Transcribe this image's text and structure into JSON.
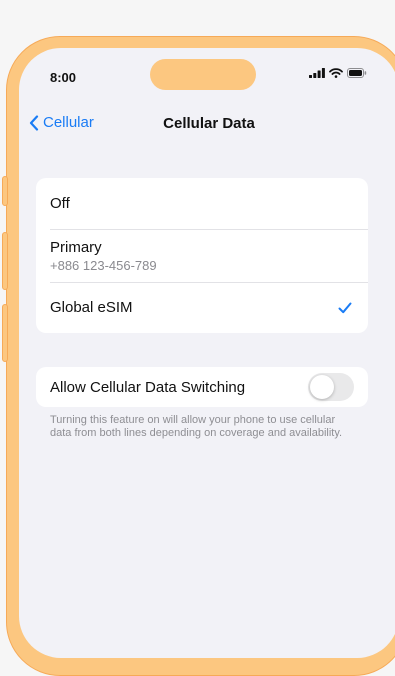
{
  "status_bar": {
    "time": "8:00"
  },
  "nav": {
    "back_label": "Cellular",
    "title": "Cellular Data"
  },
  "data_line_options": [
    {
      "label": "Off",
      "number": "",
      "selected": false
    },
    {
      "label": "Primary",
      "number": "+886 123-456-789",
      "selected": false
    },
    {
      "label": "Global eSIM",
      "number": "",
      "selected": true
    }
  ],
  "switching": {
    "label": "Allow Cellular Data Switching",
    "enabled": false,
    "description": "Turning this feature on will allow your phone to use cellular data from both lines depending on coverage and availability."
  },
  "colors": {
    "accent": "#1a7cf5",
    "frame": "#fcc780",
    "background": "#f2f2f7"
  }
}
